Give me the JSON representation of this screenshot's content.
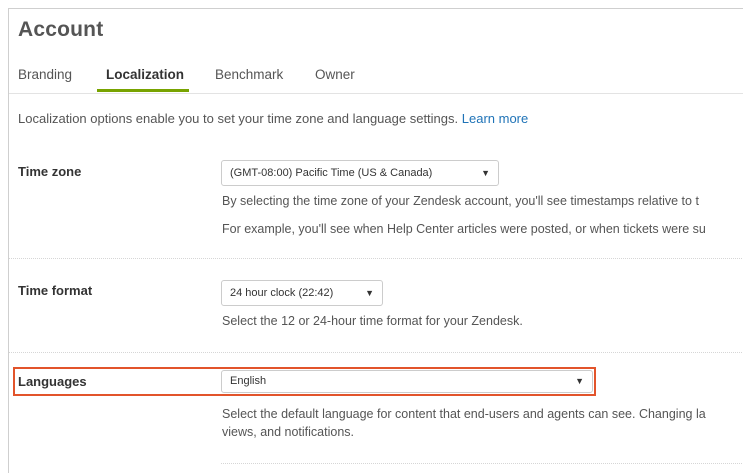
{
  "page": {
    "title": "Account"
  },
  "tabs": [
    {
      "label": "Branding",
      "active": false
    },
    {
      "label": "Localization",
      "active": true
    },
    {
      "label": "Benchmark",
      "active": false
    },
    {
      "label": "Owner",
      "active": false
    }
  ],
  "intro": {
    "text": "Localization options enable you to set your time zone and language settings. ",
    "link": "Learn more"
  },
  "time_zone": {
    "label": "Time zone",
    "selected": "(GMT-08:00) Pacific Time (US & Canada)",
    "help_line1": "By selecting the time zone of your Zendesk account, you'll see timestamps relative to t",
    "help_line2": "For example, you'll see when Help Center articles were posted, or when tickets were su"
  },
  "time_format": {
    "label": "Time format",
    "selected": "24 hour clock (22:42)",
    "help": "Select the 12 or 24-hour time format for your Zendesk."
  },
  "languages": {
    "label": "Languages",
    "selected": "English",
    "help_line1": "Select the default language for content that end-users and agents can see. Changing la",
    "help_line2": "views, and notifications."
  },
  "icons": {
    "caret": "▼"
  },
  "colors": {
    "accent_tab": "#78a300",
    "link": "#1f73b7",
    "highlight": "#e2542b"
  }
}
